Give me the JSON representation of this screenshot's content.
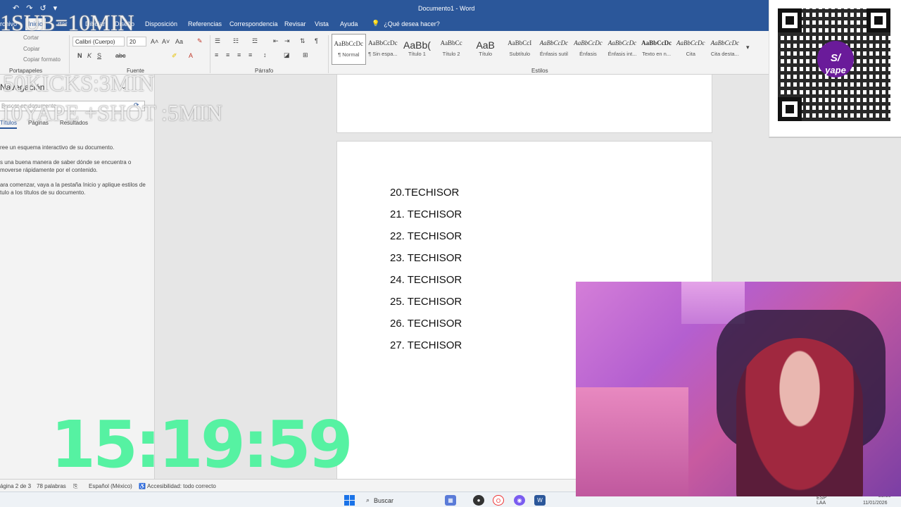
{
  "window": {
    "doc_title": "Documento1 - Word",
    "qat": [
      "↶",
      "↷",
      "↺",
      "▾"
    ]
  },
  "tabs": [
    {
      "label": "rchivo"
    },
    {
      "label": "Inicio",
      "active": true
    },
    {
      "label": "rtar"
    },
    {
      "label": "Dibujar"
    },
    {
      "label": "Diseño"
    },
    {
      "label": "Disposición"
    },
    {
      "label": "Referencias"
    },
    {
      "label": "Correspondencia"
    },
    {
      "label": "Revisar"
    },
    {
      "label": "Vista"
    },
    {
      "label": "Ayuda"
    }
  ],
  "tell_me": "¿Qué desea hacer?",
  "ribbon": {
    "clipboard": {
      "cut": "Cortar",
      "copy": "Copiar",
      "format": "Copiar formato",
      "label": "Portapapeles"
    },
    "font": {
      "name": "Calibri (Cuerpo)",
      "size": "20",
      "label": "Fuente"
    },
    "paragraph": {
      "label": "Párrafo"
    },
    "styles_label": "Estilos",
    "styles": [
      {
        "sample": "AaBbCcDc",
        "name": "¶ Normal",
        "selected": true
      },
      {
        "sample": "AaBbCcDc",
        "name": "¶ Sin espa..."
      },
      {
        "sample": "AaBb(",
        "name": "Título 1",
        "big": true
      },
      {
        "sample": "AaBbCc",
        "name": "Título 2"
      },
      {
        "sample": "AaB",
        "name": "Título",
        "big": true
      },
      {
        "sample": "AaBbCcI",
        "name": "Subtítulo"
      },
      {
        "sample": "AaBbCcDc",
        "name": "Énfasis sutil",
        "italic": true
      },
      {
        "sample": "AaBbCcDc",
        "name": "Énfasis",
        "italic": true
      },
      {
        "sample": "AaBbCcDc",
        "name": "Énfasis int...",
        "italic": true
      },
      {
        "sample": "AaBbCcDc",
        "name": "Texto en n...",
        "bold": true
      },
      {
        "sample": "AaBbCcDc",
        "name": "Cita",
        "italic": true
      },
      {
        "sample": "AaBbCcDc",
        "name": "Cita desta...",
        "italic": true
      }
    ]
  },
  "nav": {
    "title": "Navegación",
    "search_placeholder": "Buscar en documento",
    "tabs": [
      "Títulos",
      "Páginas",
      "Resultados"
    ],
    "text1": "ree un esquema interactivo de su documento.",
    "text2": "s una buena manera de saber dónde se encuentra o\nmoverse rápidamente por el contenido.",
    "text3": "ara comenzar, vaya a la pestaña Inicio y aplique estilos de\ntulo a los títulos de su documento."
  },
  "document": {
    "lines": [
      "20.TECHISOR",
      "21. TECHISOR",
      "22. TECHISOR",
      "23. TECHISOR",
      "24. TECHISOR",
      "25. TECHISOR",
      "26. TECHISOR",
      "27. TECHISOR"
    ]
  },
  "status": {
    "page": "ágina 2 de 3",
    "words": "78 palabras",
    "language": "Español (México)",
    "accessibility": "Accesibilidad: todo correcto"
  },
  "taskbar": {
    "search": "Buscar",
    "lang": "ESP\nLAA",
    "time": "23:36",
    "date": "11/01/2026"
  },
  "overlay": {
    "line1": "1SUB=10MIN",
    "line2": "50KICKS:3MIN",
    "line3": "10YAPE +SHOT :5MIN",
    "timer": "15:19:59"
  },
  "qr": {
    "badge": "S/",
    "brand": "yape"
  },
  "colors": {
    "word_blue": "#2b579a",
    "timer_green": "#56f2a2",
    "yape_purple": "#6a1b9a"
  }
}
